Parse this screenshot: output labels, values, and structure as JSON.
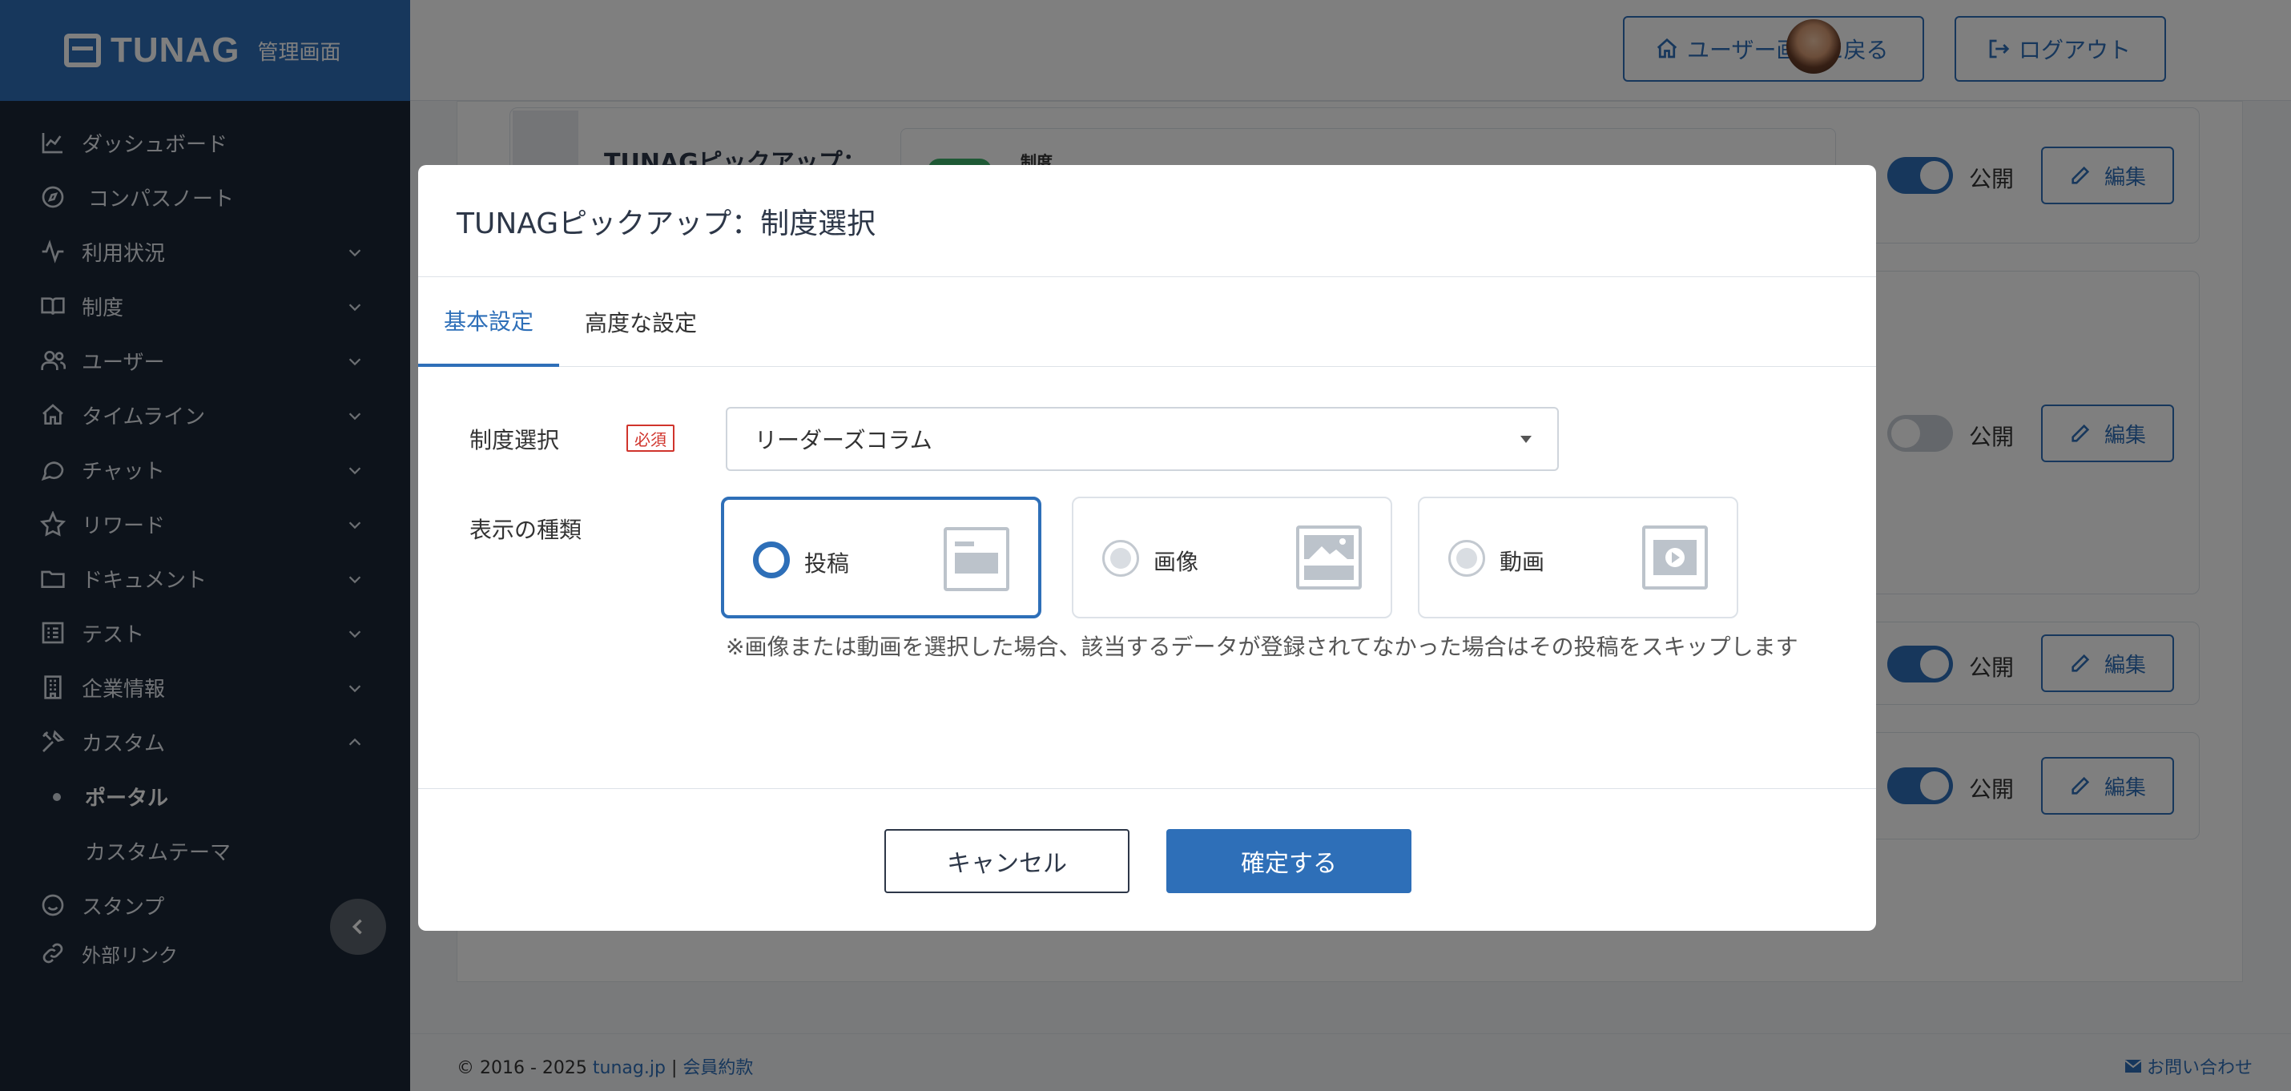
{
  "brand": {
    "name": "TUNAG",
    "subtitle": "管理画面"
  },
  "sidebar": {
    "items": [
      {
        "label": "ダッシュボード",
        "icon": "chart-line-icon",
        "expandable": false
      },
      {
        "label": "コンパスノート",
        "icon": "compass-icon",
        "expandable": false
      },
      {
        "label": "利用状況",
        "icon": "activity-icon",
        "expandable": true
      },
      {
        "label": "制度",
        "icon": "book-icon",
        "expandable": true
      },
      {
        "label": "ユーザー",
        "icon": "users-icon",
        "expandable": true
      },
      {
        "label": "タイムライン",
        "icon": "home-icon",
        "expandable": true
      },
      {
        "label": "チャット",
        "icon": "chat-icon",
        "expandable": true
      },
      {
        "label": "リワード",
        "icon": "star-icon",
        "expandable": true
      },
      {
        "label": "ドキュメント",
        "icon": "folder-icon",
        "expandable": true
      },
      {
        "label": "テスト",
        "icon": "checklist-icon",
        "expandable": true
      },
      {
        "label": "企業情報",
        "icon": "building-icon",
        "expandable": true
      },
      {
        "label": "カスタム",
        "icon": "tools-icon",
        "expandable": true,
        "expanded": true
      }
    ],
    "custom_children": [
      {
        "label": "ポータル",
        "active": true
      },
      {
        "label": "カスタムテーマ",
        "active": false
      }
    ],
    "bottom_items": [
      {
        "label": "スタンプ",
        "icon": "smile-icon"
      },
      {
        "label": "外部リンク",
        "icon": "link-icon"
      }
    ]
  },
  "topbar": {
    "back_to_user": "ユーザー画面に戻る",
    "logout": "ログアウト"
  },
  "background": {
    "card_title": "TUNAGピックアップ：",
    "card_inner_label": "制度",
    "public_label": "公開",
    "edit_label": "編集"
  },
  "footer": {
    "copyright": "© 2016 - 2025",
    "site_link": "tunag.jp",
    "separator": "|",
    "terms_link": "会員約款",
    "contact": "お問い合わせ"
  },
  "modal": {
    "title": "TUNAGピックアップ：制度選択",
    "tabs": [
      {
        "label": "基本設定",
        "active": true
      },
      {
        "label": "高度な設定",
        "active": false
      }
    ],
    "system_select": {
      "label": "制度選択",
      "required_badge": "必須",
      "value": "リーダーズコラム"
    },
    "display_type": {
      "label": "表示の種類",
      "options": [
        {
          "label": "投稿",
          "selected": true,
          "icon": "post-icon"
        },
        {
          "label": "画像",
          "selected": false,
          "icon": "image-icon"
        },
        {
          "label": "動画",
          "selected": false,
          "icon": "video-icon"
        }
      ],
      "note": "※画像または動画を選択した場合、該当するデータが登録されてなかった場合はその投稿をスキップします"
    },
    "cancel_label": "キャンセル",
    "confirm_label": "確定する"
  },
  "colors": {
    "accent": "#2e6fb8",
    "sidebar_bg": "#1a2736",
    "required": "#d0342c"
  }
}
